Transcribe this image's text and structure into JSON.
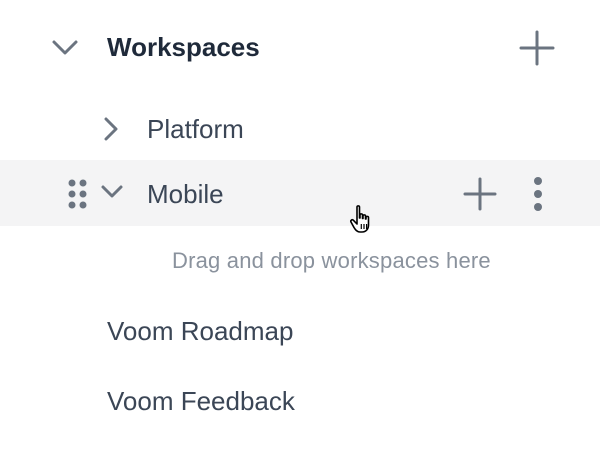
{
  "workspaces": {
    "title": "Workspaces",
    "icons": {
      "toggle": "chevron-down-icon",
      "add": "plus-icon"
    }
  },
  "items": [
    {
      "label": "Platform",
      "expanded": false,
      "icon": "chevron-right-icon"
    },
    {
      "label": "Mobile",
      "expanded": true,
      "hovered": true,
      "icons": [
        "drag-handle-icon",
        "chevron-down-icon",
        "plus-icon",
        "more-vertical-icon"
      ]
    }
  ],
  "drop_hint": "Drag and drop workspaces here",
  "plain_items": [
    {
      "label": "Voom Roadmap"
    },
    {
      "label": "Voom Feedback"
    }
  ],
  "colors": {
    "title": "#1f2a3a",
    "text": "#3b4656",
    "icon": "#6b7480",
    "hint": "#8a929d",
    "hover_bg": "#f4f4f5"
  },
  "cursor": "hand-pointer-icon"
}
